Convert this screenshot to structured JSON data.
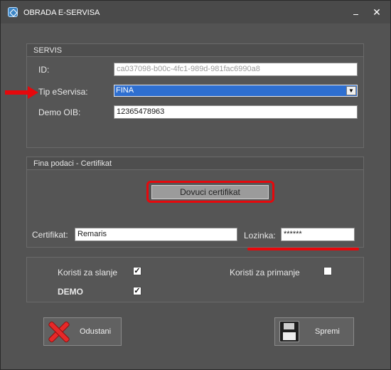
{
  "window": {
    "title": "OBRADA E-SERVISA",
    "icon": "app-icon"
  },
  "servis": {
    "title": "SERVIS",
    "id_label": "ID:",
    "id_value": "ca037098-b00c-4fc1-989d-981fac6990a8",
    "tip_label": "Tip eServisa:",
    "tip_value": "FINA",
    "oib_label": "Demo OIB:",
    "oib_value": "12365478963"
  },
  "fina": {
    "title": "Fina podaci - Certifikat",
    "download_button": "Dovuci certifikat",
    "cert_label": "Certifikat:",
    "cert_value": "Remaris",
    "password_label": "Lozinka:",
    "password_value": "******"
  },
  "options": {
    "send_label": "Koristi za slanje",
    "send_checked": true,
    "receive_label": "Koristi za primanje",
    "receive_checked": false,
    "demo_label": "DEMO",
    "demo_checked": true
  },
  "actions": {
    "cancel_label": "Odustani",
    "save_label": "Spremi"
  },
  "annotation_colors": {
    "highlight": "#e6080c"
  }
}
